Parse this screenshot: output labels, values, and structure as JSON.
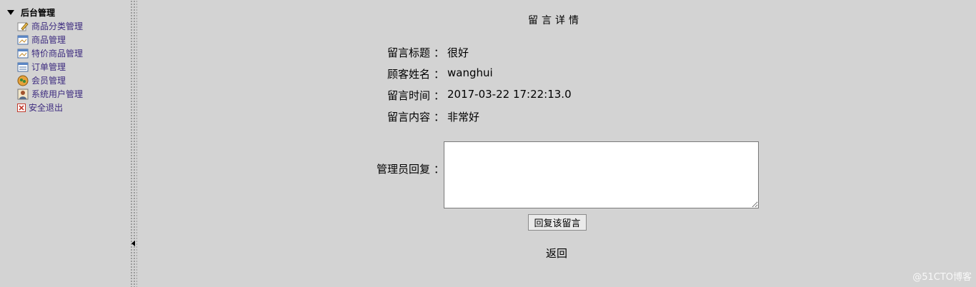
{
  "sidebar": {
    "root_label": "后台管理",
    "items": [
      {
        "label": "商品分类管理",
        "icon": "pencil-icon"
      },
      {
        "label": "商品管理",
        "icon": "window-icon"
      },
      {
        "label": "特价商品管理",
        "icon": "window-icon"
      },
      {
        "label": "订单管理",
        "icon": "list-icon"
      },
      {
        "label": "会员管理",
        "icon": "users-icon"
      },
      {
        "label": "系统用户管理",
        "icon": "user-icon"
      },
      {
        "label": "安全退出",
        "icon": "close-icon"
      }
    ]
  },
  "detail": {
    "title": "留言详情",
    "colon": "：",
    "fields": [
      {
        "label": "留言标题",
        "value": "很好"
      },
      {
        "label": "顾客姓名",
        "value": "wanghui"
      },
      {
        "label": "留言时间",
        "value": "2017-03-22 17:22:13.0"
      },
      {
        "label": "留言内容",
        "value": "非常好"
      }
    ],
    "reply_label": "管理员回复",
    "reply_value": "",
    "reply_button": "回复该留言",
    "back_link": "返回"
  },
  "watermark": "@51CTO博客"
}
